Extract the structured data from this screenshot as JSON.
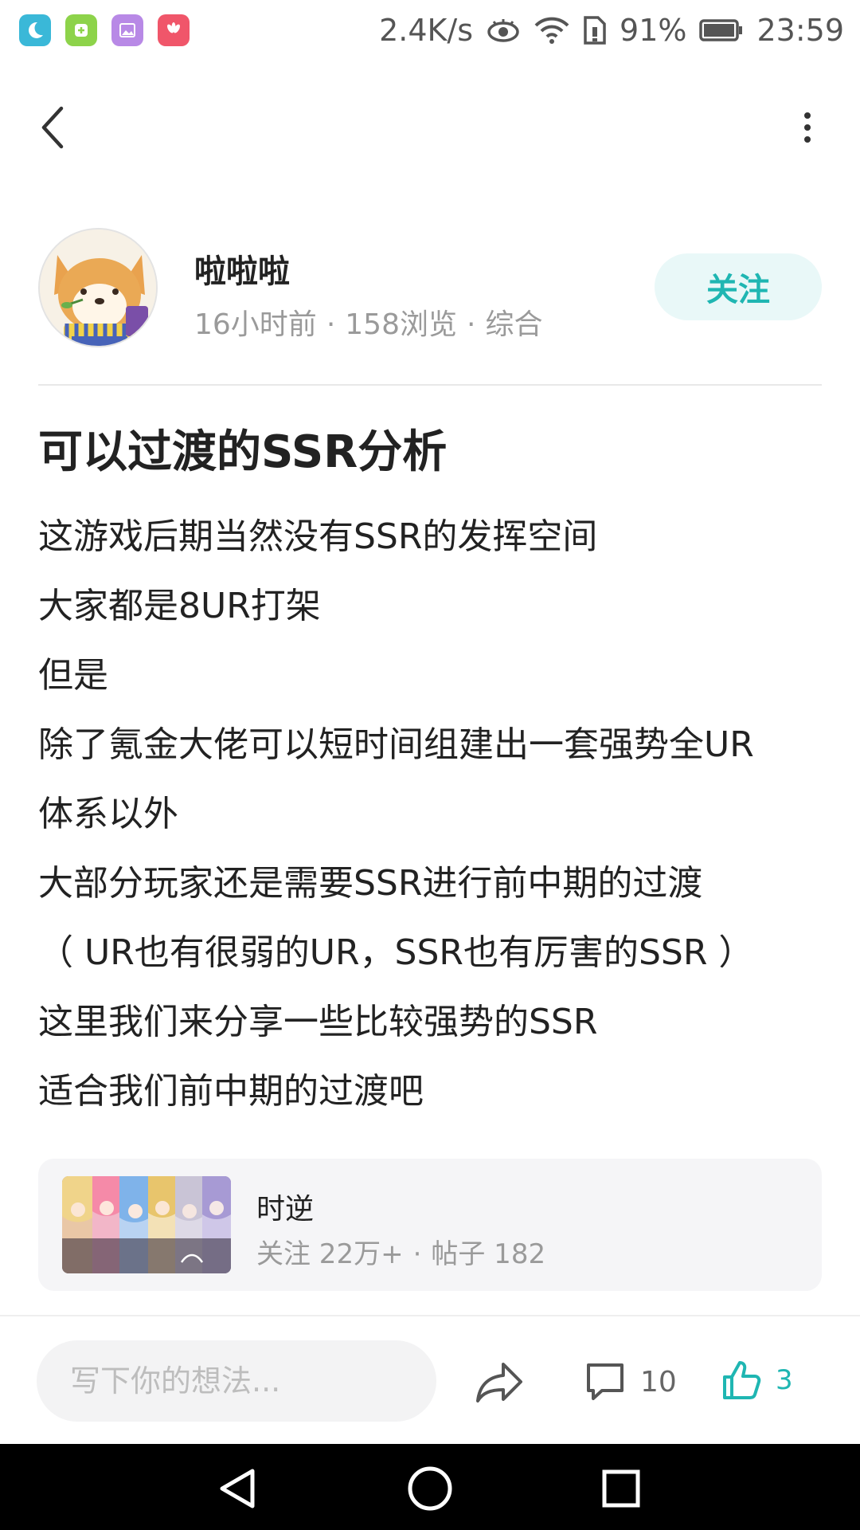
{
  "status_bar": {
    "network_speed": "2.4K/s",
    "battery_percent": "91%",
    "time": "23:59",
    "icons": [
      "moon-app-icon",
      "green-app-icon",
      "gallery-app-icon",
      "huawei-app-icon",
      "eye-icon",
      "wifi-icon",
      "sim-icon",
      "battery-icon"
    ]
  },
  "nav": {
    "back_icon": "chevron-left-icon",
    "more_icon": "more-vertical-icon"
  },
  "author": {
    "name": "啦啦啦",
    "time": "16小时前",
    "views": "158浏览",
    "category": "综合",
    "separator": "·",
    "follow_label": "关注"
  },
  "post": {
    "title": "可以过渡的SSR分析",
    "lines": [
      "这游戏后期当然没有SSR的发挥空间",
      "大家都是8UR打架",
      "但是",
      "除了氪金大佬可以短时间组建出一套强势全UR",
      "体系以外",
      "大部分玩家还是需要SSR进行前中期的过渡",
      "（ UR也有很弱的UR，SSR也有厉害的SSR ）",
      "这里我们来分享一些比较强势的SSR",
      "适合我们前中期的过渡吧"
    ]
  },
  "topic": {
    "name": "时逆",
    "followers": "关注 22万+",
    "posts": "帖子 182",
    "separator": "·"
  },
  "actions": {
    "comment_placeholder": "写下你的想法...",
    "comment_count": "10",
    "like_count": "3",
    "accent_color": "#1fb6b2"
  },
  "system_nav": {
    "icons": [
      "back-triangle-icon",
      "home-circle-icon",
      "recents-square-icon"
    ]
  }
}
